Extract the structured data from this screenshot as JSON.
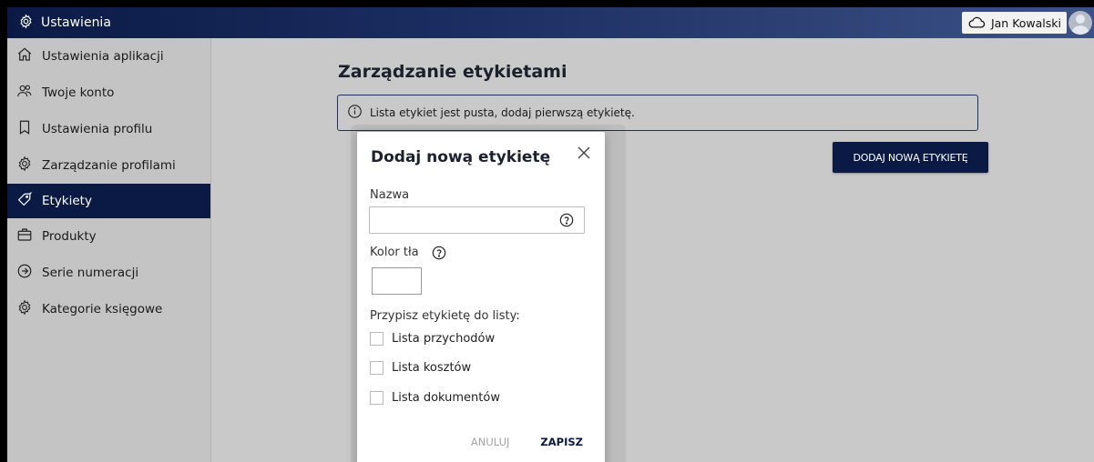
{
  "topbar": {
    "title": "Ustawienia",
    "title_icon": "gear-icon",
    "user_icon": "cloud-icon",
    "user_name": "Jan Kowalski"
  },
  "sidebar": {
    "items": [
      {
        "label": "Ustawienia aplikacji",
        "icon": "home-icon"
      },
      {
        "label": "Twoje konto",
        "icon": "users-icon"
      },
      {
        "label": "Ustawienia profilu",
        "icon": "bookmark-icon"
      },
      {
        "label": "Zarządzanie profilami",
        "icon": "gear-icon"
      },
      {
        "label": "Etykiety",
        "icon": "tag-icon",
        "active": true
      },
      {
        "label": "Produkty",
        "icon": "briefcase-icon"
      },
      {
        "label": "Serie numeracji",
        "icon": "arrow-circle-icon"
      },
      {
        "label": "Kategorie księgowe",
        "icon": "gear-icon"
      }
    ]
  },
  "main": {
    "title": "Zarządzanie etykietami",
    "info_text": "Lista etykiet jest pusta, dodaj pierwszą etykietę.",
    "add_button": "DODAJ NOWĄ ETYKIETĘ"
  },
  "modal": {
    "title": "Dodaj nową etykietę",
    "name_label": "Nazwa",
    "name_value": "",
    "color_label": "Kolor tła",
    "assign_label": "Przypisz etykietę do listy:",
    "checkboxes": [
      {
        "label": "Lista przychodów",
        "checked": false
      },
      {
        "label": "Lista kosztów",
        "checked": false
      },
      {
        "label": "Lista dokumentów",
        "checked": false
      }
    ],
    "cancel": "ANULUJ",
    "save": "ZAPISZ"
  },
  "colors": {
    "navy": "#0b1a45",
    "background": "#c9c9c9",
    "modal": "#ffffff"
  }
}
